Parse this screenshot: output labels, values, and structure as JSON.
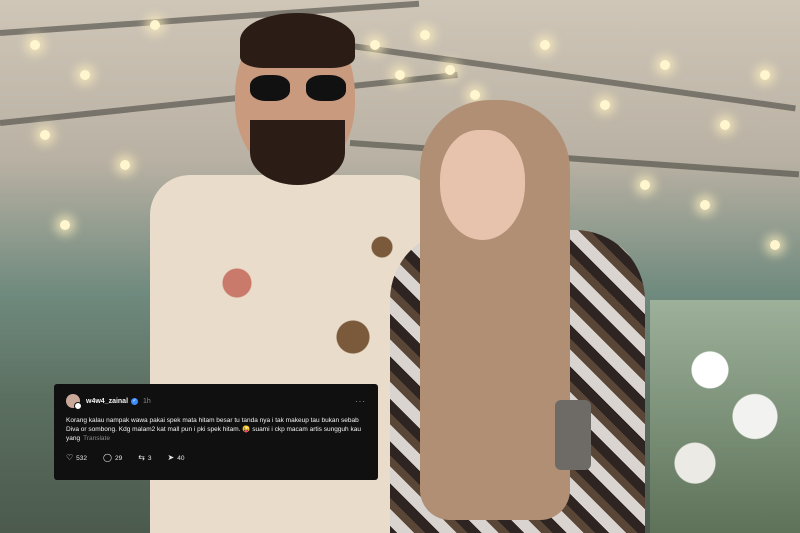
{
  "post": {
    "username": "w4w4_zainal",
    "time": "1h",
    "more_label": "···",
    "text": "Korang kalau nampak wawa pakai spek mata hitam besar tu tanda nya i tak makeup tau bukan sebab Diva or sombong. Kdg malam2 kat mall pun i pki spek hitam. 😜 suami i ckp macam artis sungguh kau yang",
    "translate_label": "Translate",
    "likes": "532",
    "comments": "29",
    "reposts": "3",
    "shares": "40"
  },
  "icons": {
    "like": "heart-icon",
    "comment": "comment-icon",
    "repost": "repost-icon",
    "share": "send-icon",
    "verified": "verified-badge-icon"
  },
  "colors": {
    "card_bg": "#101010",
    "verified": "#3f8cff"
  }
}
